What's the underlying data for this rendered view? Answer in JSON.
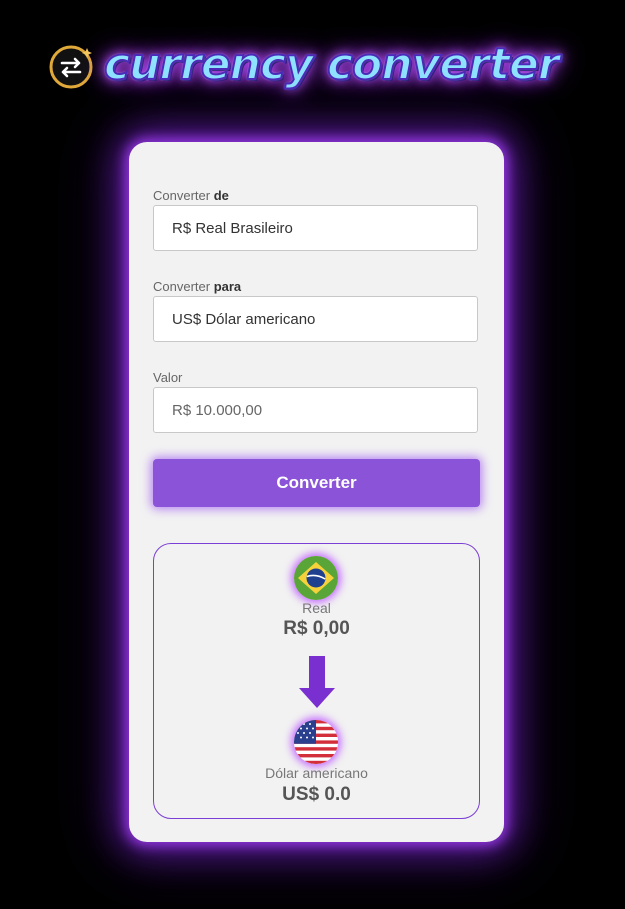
{
  "app": {
    "title": "currency converter"
  },
  "form": {
    "from": {
      "label_prefix": "Converter ",
      "label_emphasis": "de",
      "value": "R$ Real Brasileiro"
    },
    "to": {
      "label_prefix": "Converter ",
      "label_emphasis": "para",
      "value": "US$ Dólar americano"
    },
    "amount": {
      "label": "Valor",
      "placeholder": "R$ 10.000,00"
    },
    "submit_label": "Converter"
  },
  "result": {
    "source": {
      "currency_name": "Real",
      "amount": "R$ 0,00",
      "flag_icon": "brazil-flag-icon"
    },
    "target": {
      "currency_name": "Dólar americano",
      "amount": "US$ 0.0",
      "flag_icon": "usa-flag-icon"
    }
  },
  "colors": {
    "background": "#000000",
    "card": "#f2f2f2",
    "accent": "#8a53d8",
    "glow": "#a03cf0",
    "arrow": "#7a2fd0"
  }
}
